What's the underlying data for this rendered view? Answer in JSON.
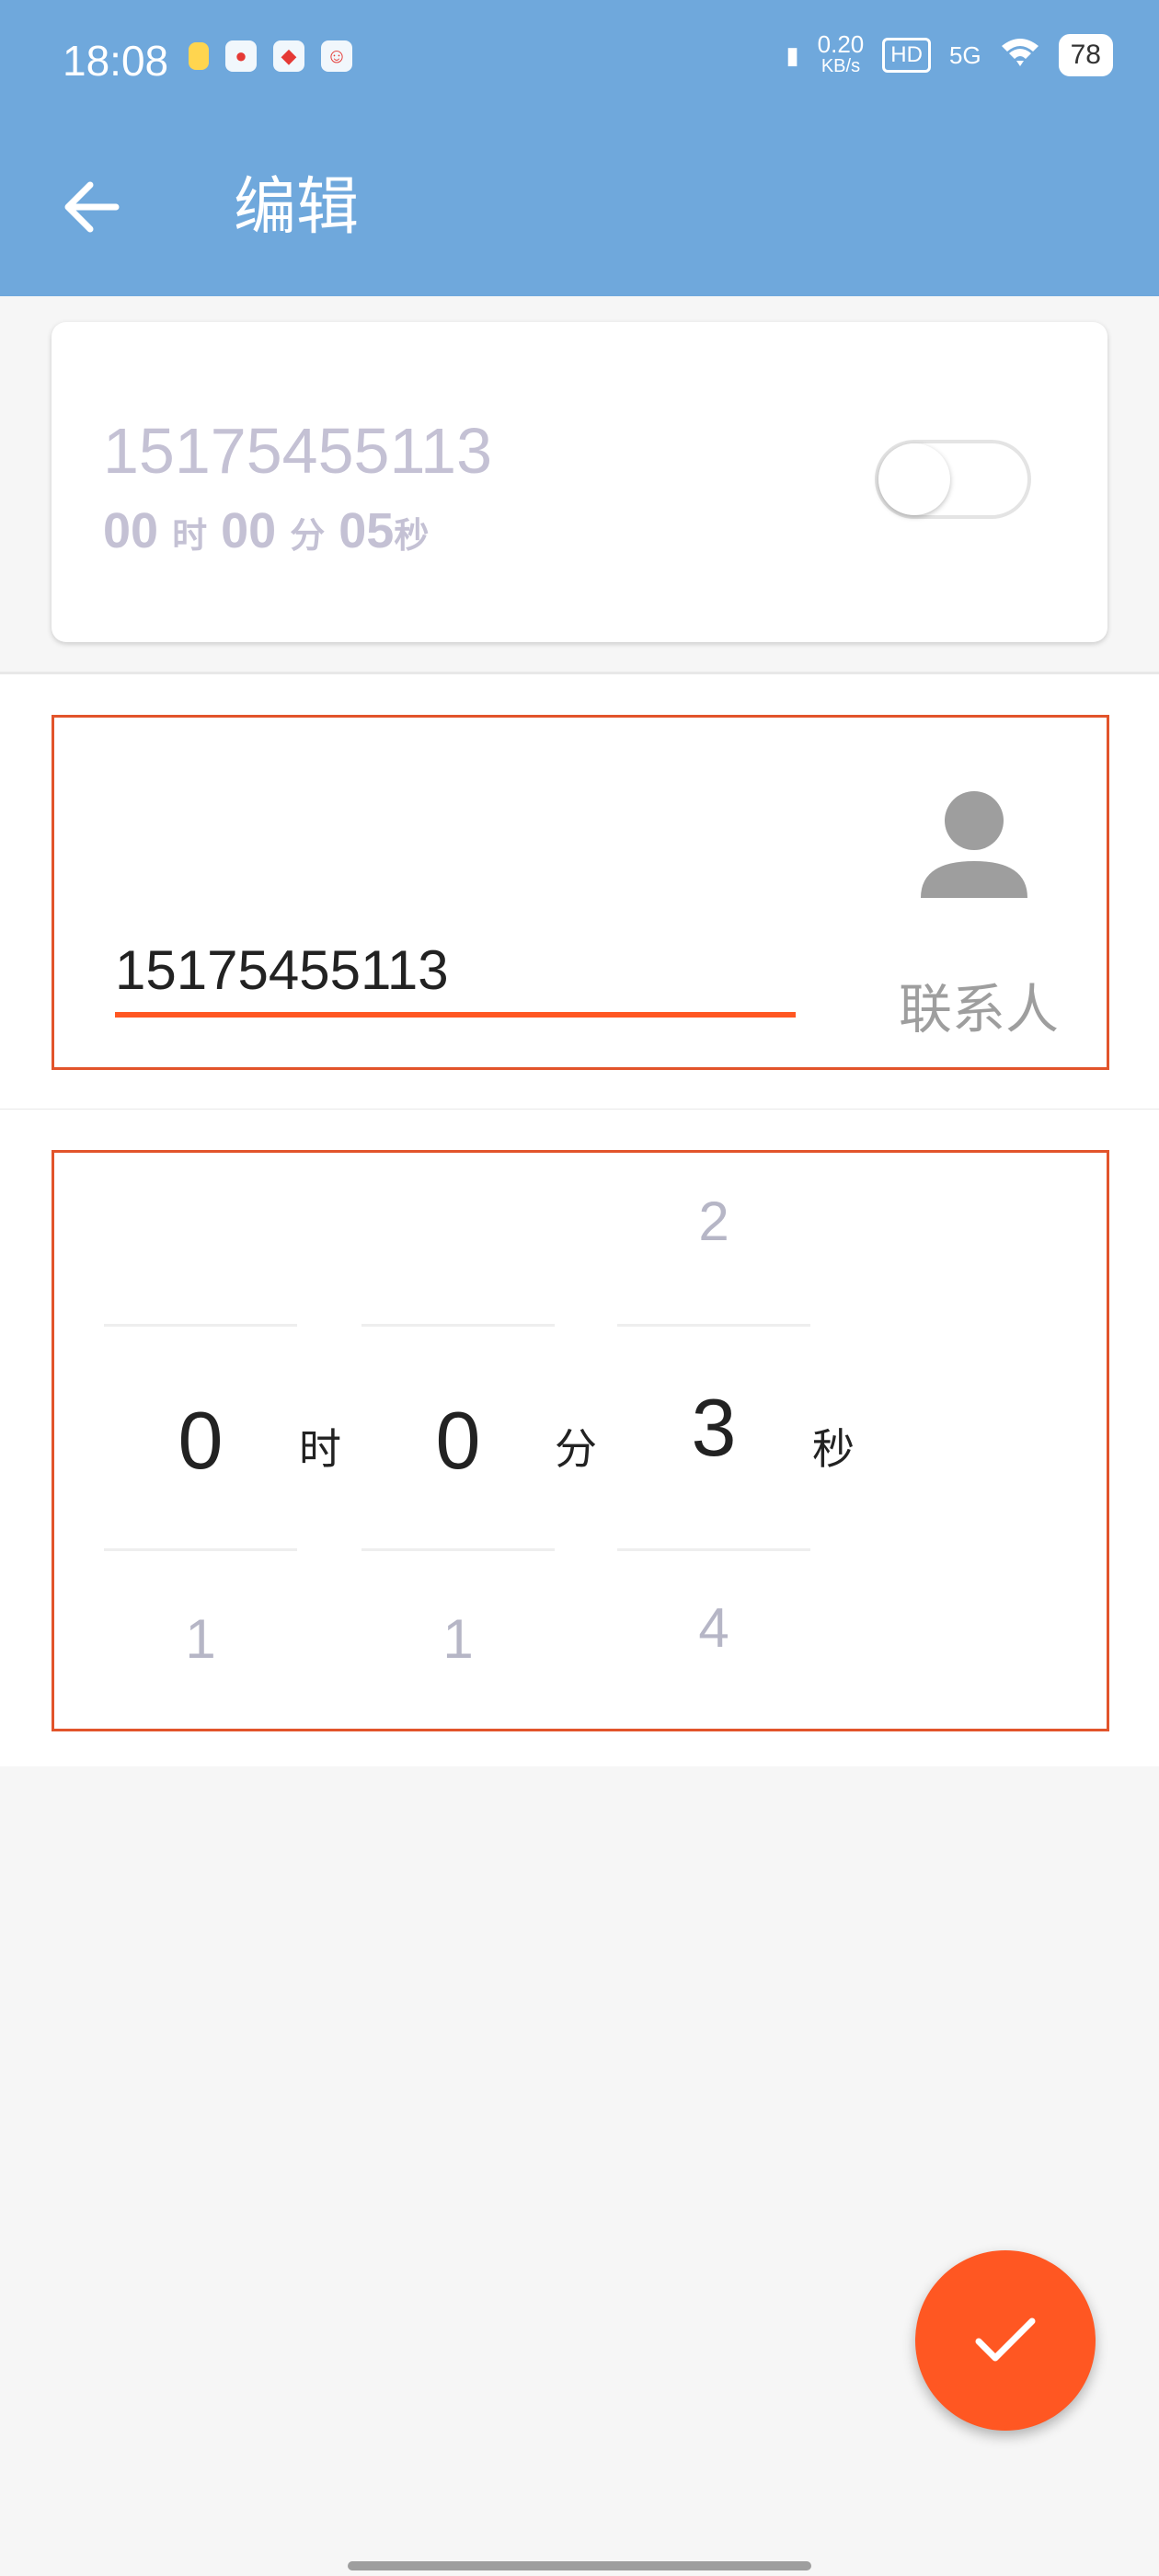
{
  "status_bar": {
    "time": "18:08",
    "speed_value": "0.20",
    "speed_unit": "KB/s",
    "hd": "HD",
    "network": "5G",
    "battery": "78"
  },
  "toolbar": {
    "title": "编辑",
    "back_icon": "arrow-left-icon"
  },
  "alarm_card": {
    "number": "15175455113",
    "hours": "00",
    "hours_unit": "时",
    "minutes": "00",
    "minutes_unit": "分",
    "seconds": "05",
    "seconds_unit": "秒",
    "enabled": false
  },
  "phone_section": {
    "input_value": "15175455113",
    "contact_label": "联系人",
    "contact_icon": "person-icon"
  },
  "timer_picker": {
    "hours": {
      "prev": "",
      "selected": "0",
      "next": "1",
      "unit": "时"
    },
    "minutes": {
      "prev": "",
      "selected": "0",
      "next": "1",
      "unit": "分"
    },
    "seconds": {
      "prev": "2",
      "selected": "3",
      "next": "4",
      "unit": "秒"
    }
  },
  "fab": {
    "icon": "check-icon"
  },
  "colors": {
    "header": "#6fa8dc",
    "accent": "#ff5722",
    "border": "#e2542b"
  }
}
